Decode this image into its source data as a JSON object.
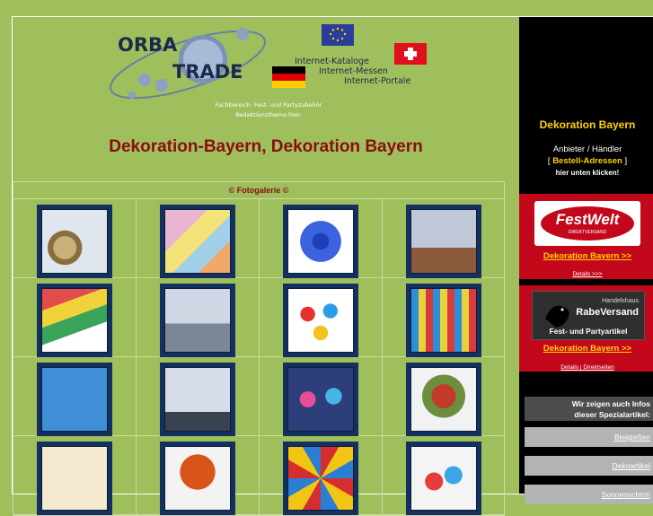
{
  "header": {
    "logo": {
      "word1": "ORBA",
      "word2": "TRADE"
    },
    "taglines": [
      "Internet-Kataloge",
      "Internet-Messen",
      "Internet-Portale"
    ],
    "notes": [
      "Fachbereich: Fest- und Partyzubehör",
      "Redaktionsthema hier:"
    ]
  },
  "page_title": "Dekoration-Bayern, Dekoration Bayern",
  "gallery": {
    "heading": "© Fotogalerie ©",
    "thumbs": [
      "glass-vases",
      "tissue-paper-colors",
      "blue-paper-fan",
      "candle-holder",
      "crepe-paper-rolls",
      "candle-arrangement",
      "party-balloons",
      "paper-garland",
      "champagne-bottles",
      "glass-vase-stones",
      "party-decoration",
      "red-candles",
      "champagne-glasses",
      "flower-arrangement",
      "colorful-fans",
      "paper-plates"
    ]
  },
  "sidebar": {
    "heading": "Dekoration Bayern",
    "sub1": "Anbieter / Händler",
    "sub2_open": "[",
    "sub2_link": "Bestell-Adressen",
    "sub2_close": "]",
    "sub3": "hier unten klicken!",
    "promo1": {
      "brand": "FestWelt",
      "brand_sub": "DIREKTVERSAND",
      "link": "Dekoration Bayern >>",
      "details": "Details >>>"
    },
    "promo2": {
      "brand_top": "Handelshaus",
      "brand": "RabeVersand",
      "brand_sub": "Fest- und Partyartikel",
      "link": "Dekoration Bayern >>",
      "details": "Details | Direktseiten"
    },
    "info_line1": "Wir zeigen auch Infos",
    "info_line2": "dieser Spezialartikel:",
    "buttons": [
      "Bleigießen",
      "Dekoartikel",
      "Sonnenschirm"
    ]
  },
  "colors": {
    "page_bg": "#9fbf5c",
    "title": "#8b0d14",
    "accent_red": "#c4081c",
    "accent_yellow": "#ffd400"
  }
}
